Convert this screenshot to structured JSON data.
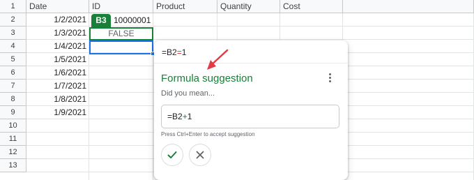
{
  "columns": [
    "Date",
    "ID",
    "Product",
    "Quantity",
    "Cost"
  ],
  "rows": [
    {
      "num": "1",
      "date": "",
      "id": ""
    },
    {
      "num": "2",
      "date": "1/2/2021",
      "id": ""
    },
    {
      "num": "3",
      "date": "1/3/2021",
      "id": ""
    },
    {
      "num": "4",
      "date": "1/4/2021",
      "id": ""
    },
    {
      "num": "5",
      "date": "1/5/2021",
      "id": ""
    },
    {
      "num": "6",
      "date": "1/6/2021",
      "id": ""
    },
    {
      "num": "7",
      "date": "1/7/2021",
      "id": ""
    },
    {
      "num": "8",
      "date": "1/8/2021",
      "id": ""
    },
    {
      "num": "9",
      "date": "1/9/2021",
      "id": ""
    },
    {
      "num": "10",
      "date": "",
      "id": ""
    },
    {
      "num": "11",
      "date": "",
      "id": ""
    },
    {
      "num": "12",
      "date": "",
      "id": ""
    },
    {
      "num": "13",
      "date": "",
      "id": ""
    }
  ],
  "b2_value": "10000001",
  "b3_tag": "B3",
  "b3_value": "FALSE",
  "popup": {
    "formula_prefix": "=B2",
    "formula_op": "=",
    "formula_suffix": "1",
    "title": "Formula suggestion",
    "subtitle": "Did you mean...",
    "suggestion_prefix": "=B2",
    "suggestion_op": "+",
    "suggestion_suffix": "1",
    "hint": "Press Ctrl+Enter to accept suggestion"
  },
  "icons": {
    "accept": "check-icon",
    "dismiss": "close-icon",
    "menu": "more-vert-icon",
    "annotation": "red-arrow-icon"
  },
  "colors": {
    "accent_green": "#188038",
    "selection_blue": "#1a73e8",
    "arrow_red": "#e53945"
  }
}
